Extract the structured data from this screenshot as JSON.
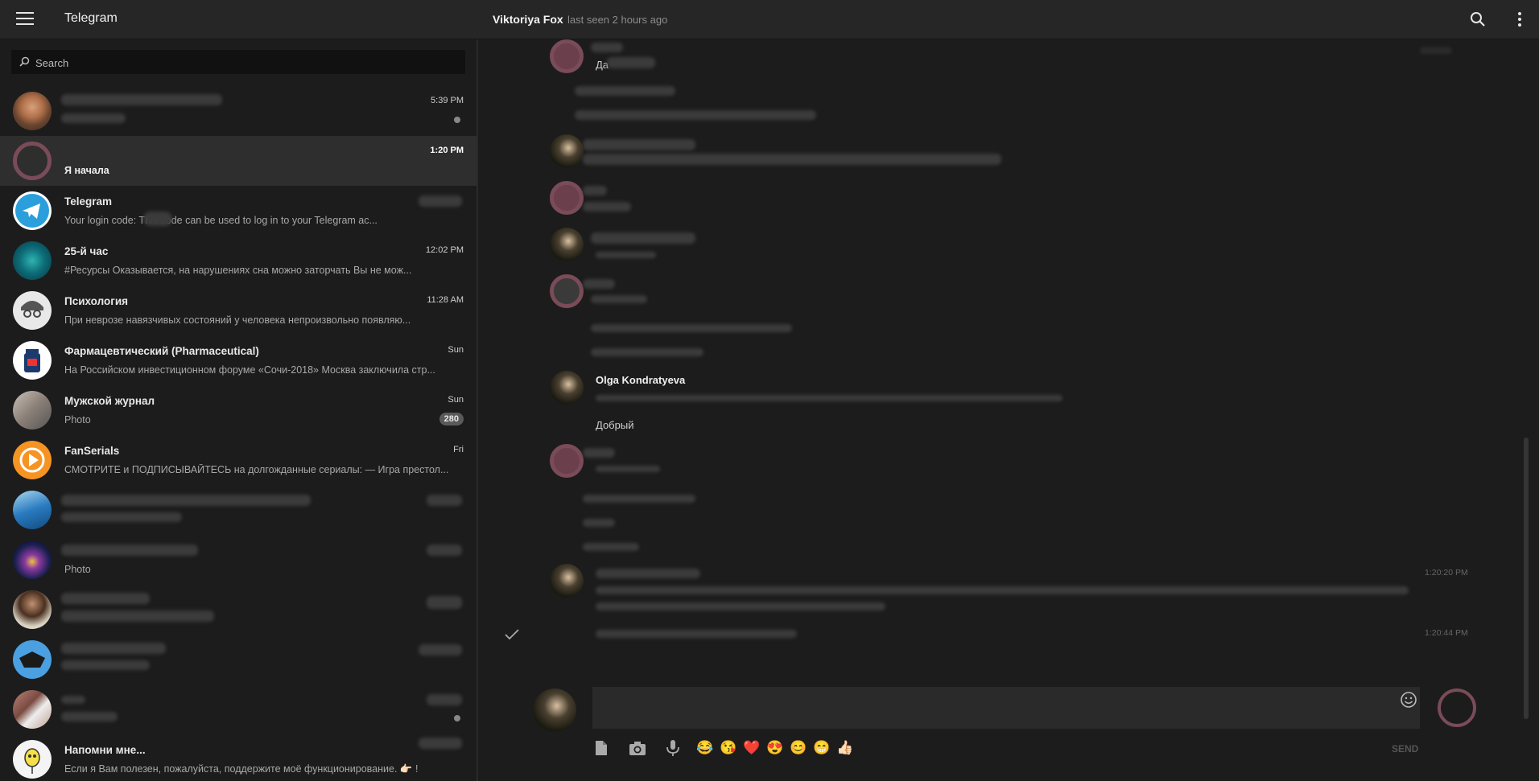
{
  "app": {
    "title": "Telegram"
  },
  "header": {
    "peer_name": "Viktoriya Fox",
    "peer_status": "last seen 2 hours ago"
  },
  "sidebar": {
    "search_placeholder": "Search",
    "dialogs": [
      {
        "title": "",
        "text": "",
        "time": "5:39 PM",
        "avatar": "photo-man-icon",
        "unread_dot": true
      },
      {
        "title": "",
        "text": "Я начала",
        "time": "1:20 PM",
        "avatar": "ring-placeholder-icon",
        "active": true
      },
      {
        "title": "Telegram",
        "text": "Your login code:         This code can be used to log in to your Telegram ac...",
        "time": "",
        "avatar": "telegram-plane-icon"
      },
      {
        "title": "25-й час",
        "text": "#Ресурсы Оказывается, на нарушениях сна можно заторчать Вы не мож...",
        "time": "12:02 PM",
        "avatar": "brain-icon"
      },
      {
        "title": "Психология",
        "text": "При неврозе навязчивых состояний у человека непроизвольно появляю...",
        "time": "11:28 AM",
        "avatar": "glasses-face-icon"
      },
      {
        "title": "Фармацевтический (Pharmaceutical)",
        "text": "На Российском инвестиционном форуме «Сочи-2018» Москва заключила стр...",
        "time": "Sun",
        "avatar": "pill-bottle-icon"
      },
      {
        "title": "Мужской журнал",
        "text": "Photo",
        "time": "Sun",
        "badge": "280",
        "avatar": "photo-hand-icon"
      },
      {
        "title": "FanSerials",
        "text": "СМОТРИТЕ и ПОДПИСЫВАЙТЕСЬ на долгожданные сериалы: — Игра престол...",
        "time": "Fri",
        "avatar": "play-icon"
      },
      {
        "title": "",
        "text": "",
        "time": "",
        "avatar": "wave-photo-icon"
      },
      {
        "title": "",
        "text": "Photo",
        "time": "",
        "avatar": "space-photo-icon"
      },
      {
        "title": "",
        "text": "",
        "time": "",
        "avatar": "person-photo-icon"
      },
      {
        "title": "",
        "text": "",
        "time": "",
        "avatar": "blue-photo-icon"
      },
      {
        "title": "",
        "text": "",
        "time": "",
        "avatar": "paper-photo-icon",
        "unread_dot": true
      },
      {
        "title": "Напомни мне...",
        "text": "Если я Вам полезен, пожалуйста, поддержите моё функционирование. 👉🏻 !",
        "time": "",
        "avatar": "robot-icon"
      }
    ]
  },
  "chat": {
    "messages": {
      "m1_text": "Да",
      "olga_author": "Olga Kondratyeva",
      "olga_text": "Добрый",
      "time_1": "1:20:20 PM",
      "time_2": "1:20:44 PM"
    },
    "composer": {
      "placeholder": "",
      "send_label": "SEND",
      "quick_emoji": [
        "😂",
        "😘",
        "❤️",
        "😍",
        "😊",
        "😁",
        "👍🏻"
      ]
    }
  },
  "colors": {
    "accent_ring": "#7a4b58",
    "background": "#1c1c1c",
    "header": "#262626"
  }
}
